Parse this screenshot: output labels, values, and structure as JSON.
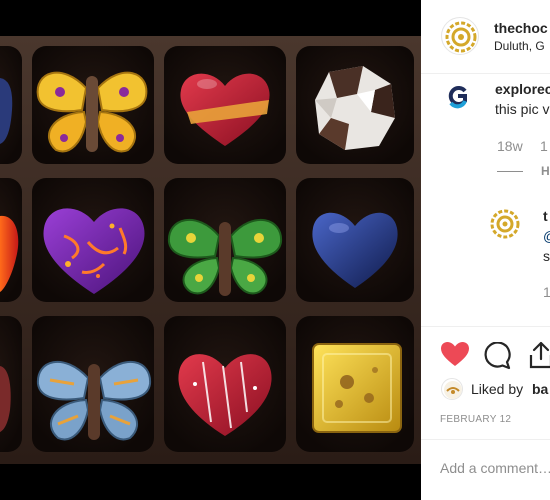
{
  "post": {
    "owner_name": "thechoc",
    "owner_location": "Duluth, G"
  },
  "comments": [
    {
      "user": "explorec",
      "text": "this pic v",
      "time": "18w",
      "likes": "1",
      "replies_toggle": "H"
    }
  ],
  "reply": {
    "user": "t",
    "mention": "@",
    "text": "s",
    "time": "1"
  },
  "likes": {
    "prefix": "Liked by",
    "name": "ba"
  },
  "date": "FEBRUARY 12",
  "comment_box": {
    "placeholder": "Add a comment…"
  },
  "icons": {
    "like": "heart-filled-icon",
    "comment": "speech-bubble-icon",
    "share": "share-arrow-icon"
  },
  "colors": {
    "like_red": "#ed4956",
    "text_dark": "#262626",
    "text_muted": "#8e8e8e",
    "tray_brown": "#3b2a22",
    "logo_gold": "#d4a82a"
  }
}
